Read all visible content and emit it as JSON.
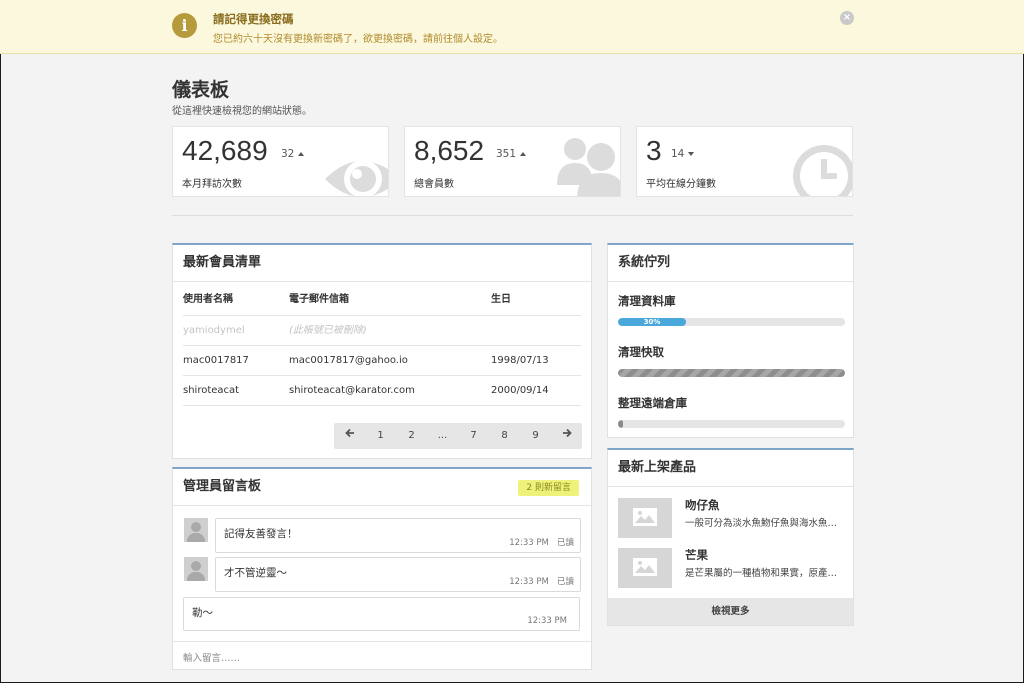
{
  "alert": {
    "title": "請記得更換密碼",
    "message": "您已約六十天沒有更換新密碼了，欲更換密碼，請前往個人設定。",
    "icon": "info-icon",
    "close_icon": "close-icon"
  },
  "header": {
    "title": "儀表板",
    "subtitle": "從這裡快速檢視您的網站狀態。"
  },
  "stats": [
    {
      "value": "42,689",
      "delta": "32",
      "trend": "up",
      "label": "本月拜訪次數",
      "icon": "eye-icon"
    },
    {
      "value": "8,652",
      "delta": "351",
      "trend": "up",
      "label": "總會員數",
      "icon": "users-icon"
    },
    {
      "value": "3",
      "delta": "14",
      "trend": "down",
      "label": "平均在線分鐘數",
      "icon": "clock-icon"
    }
  ],
  "members": {
    "title": "最新會員清單",
    "columns": [
      "使用者名稱",
      "電子郵件信箱",
      "生日"
    ],
    "rows": [
      {
        "username": "yamiodymel",
        "email": "(此帳號已被刪除)",
        "birthday": "",
        "deleted": true
      },
      {
        "username": "mac0017817",
        "email": "mac0017817@gahoo.io",
        "birthday": "1998/07/13",
        "deleted": false
      },
      {
        "username": "shiroteacat",
        "email": "shiroteacat@karator.com",
        "birthday": "2000/09/14",
        "deleted": false
      }
    ],
    "pagination": [
      "1",
      "2",
      "...",
      "7",
      "8",
      "9"
    ],
    "prev_icon": "arrow-left-icon",
    "next_icon": "arrow-right-icon"
  },
  "chat": {
    "title": "管理員留言板",
    "badge": "2 則新留言",
    "messages": [
      {
        "text": "記得友善發言！",
        "time": "12:33 PM",
        "status": "已讀",
        "side": "left"
      },
      {
        "text": "才不管逆靈～",
        "time": "12:33 PM",
        "status": "已讀",
        "side": "left"
      },
      {
        "text": "勒～",
        "time": "12:33 PM",
        "status": "",
        "side": "right"
      }
    ],
    "input_placeholder": "輸入留言……"
  },
  "queue": {
    "title": "系統佇列",
    "tasks": [
      {
        "label": "清理資料庫",
        "progress": 0.3,
        "progress_text": "30%",
        "style": "blue"
      },
      {
        "label": "清理快取",
        "progress": 1.0,
        "progress_text": "",
        "style": "striped"
      },
      {
        "label": "整理遠端倉庫",
        "progress": 0.02,
        "progress_text": "",
        "style": "dark"
      }
    ]
  },
  "products": {
    "title": "最新上架產品",
    "items": [
      {
        "name": "吻仔魚",
        "desc": "一般可分為淡水魚魩仔魚與海水魚…"
      },
      {
        "name": "芒果",
        "desc": "是芒果屬的一種植物和果實，原產…"
      }
    ],
    "more_label": "檢視更多"
  },
  "colors": {
    "alert_bg": "#fbf8dd",
    "alert_title": "#8a6d1e",
    "panel_accent": "#7fa6c9",
    "progress_blue": "#4aa7d9",
    "badge_bg": "#eef27a"
  }
}
